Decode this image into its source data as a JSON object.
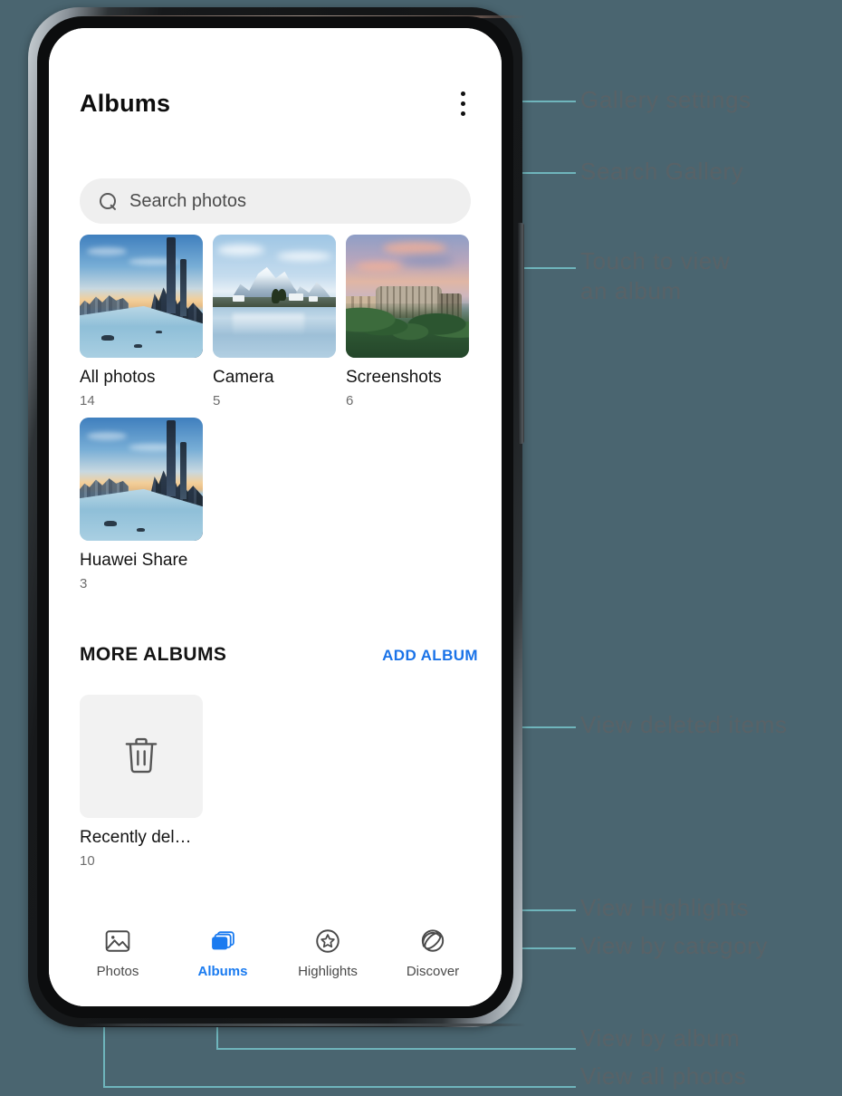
{
  "app": {
    "title": "Albums",
    "menu_icon": "kebab-menu-icon",
    "search": {
      "placeholder": "Search photos",
      "value": "",
      "icon": "search-icon"
    }
  },
  "albums": [
    {
      "name": "All photos",
      "count": "14",
      "art": "city"
    },
    {
      "name": "Camera",
      "count": "5",
      "art": "lake"
    },
    {
      "name": "Screenshots",
      "count": "6",
      "art": "rome"
    },
    {
      "name": "Huawei Share",
      "count": "3",
      "art": "city"
    }
  ],
  "more_albums": {
    "title": "MORE ALBUMS",
    "add_label": "ADD ALBUM",
    "items": [
      {
        "name": "Recently del…",
        "count": "10",
        "icon": "trash-icon"
      }
    ]
  },
  "bottom_nav": {
    "active": "Albums",
    "items": [
      {
        "label": "Photos",
        "icon": "photo-icon"
      },
      {
        "label": "Albums",
        "icon": "albums-stack-icon"
      },
      {
        "label": "Highlights",
        "icon": "star-circle-icon"
      },
      {
        "label": "Discover",
        "icon": "planet-icon"
      }
    ]
  },
  "annotations": [
    {
      "text": "Gallery settings"
    },
    {
      "text": "Search Gallery"
    },
    {
      "text": "Touch to view\nan album"
    },
    {
      "text": "View deleted items"
    },
    {
      "text": "View Highlights"
    },
    {
      "text": "View by category"
    },
    {
      "text": "View by album"
    },
    {
      "text": "View all photos"
    }
  ],
  "colors": {
    "background": "#4a6570",
    "accent_blue": "#1a7bf0",
    "link_blue": "#1a73e8",
    "leader_line": "#6fb5bc",
    "annotation_text": "#7a5d55"
  }
}
